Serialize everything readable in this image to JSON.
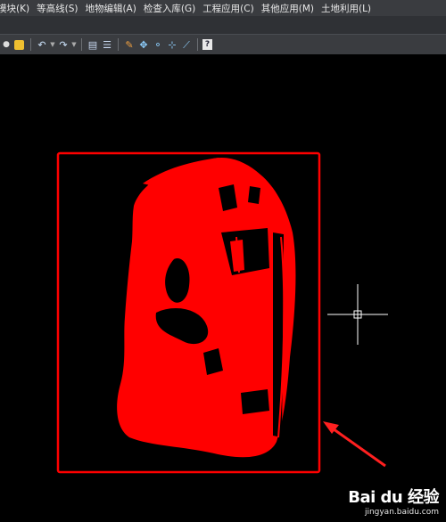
{
  "menubar": {
    "items": [
      {
        "label": "模块(K)"
      },
      {
        "label": "等高线(S)"
      },
      {
        "label": "地物编辑(A)"
      },
      {
        "label": "检查入库(G)"
      },
      {
        "label": "工程应用(C)"
      },
      {
        "label": "其他应用(M)"
      },
      {
        "label": "土地利用(L)"
      }
    ]
  },
  "toolbar": {
    "icons": [
      "zoom-icon",
      "undo-icon",
      "redo-icon",
      "properties-icon",
      "list-icon",
      "pencil-icon",
      "move-icon",
      "node-icon",
      "trim-icon",
      "extend-icon",
      "help-icon"
    ],
    "help_label": "?"
  },
  "canvas": {
    "background": "#000000",
    "selection_color": "#ff0000",
    "crosshair_color": "#ffffff",
    "annotation_arrow_color": "#ff2020"
  },
  "watermark": {
    "brand": "Bai du 经验",
    "url": "jingyan.baidu.com"
  }
}
